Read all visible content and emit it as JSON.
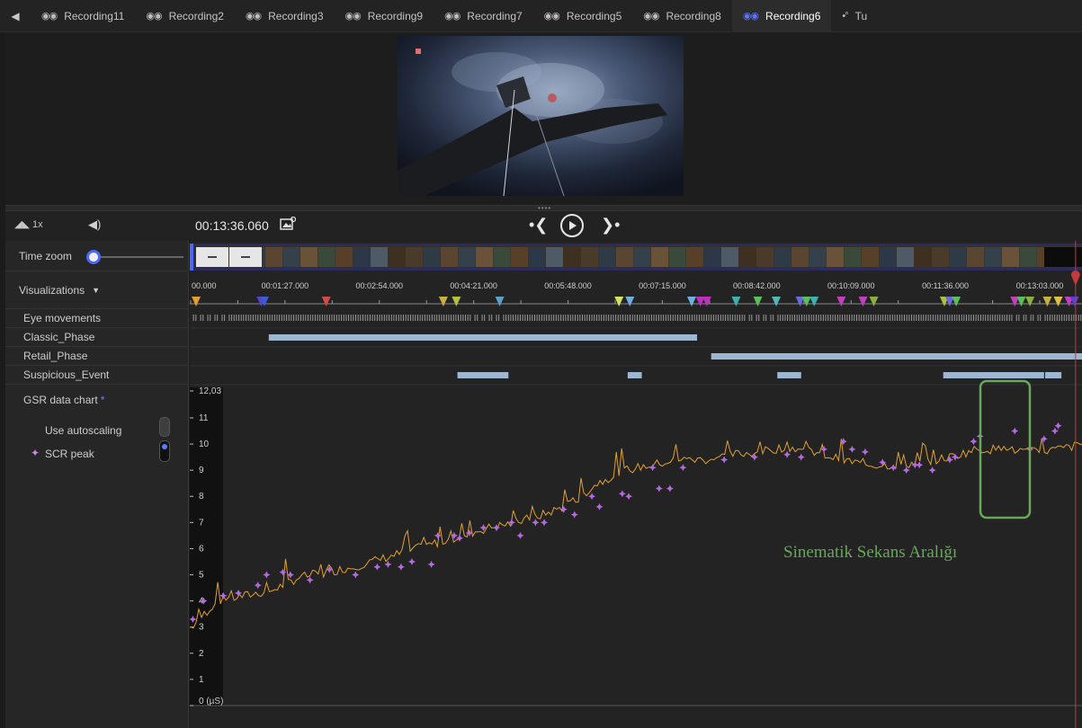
{
  "tabs": [
    {
      "label": "Recording11",
      "active": false
    },
    {
      "label": "Recording2",
      "active": false
    },
    {
      "label": "Recording3",
      "active": false
    },
    {
      "label": "Recording9",
      "active": false
    },
    {
      "label": "Recording7",
      "active": false
    },
    {
      "label": "Recording5",
      "active": false
    },
    {
      "label": "Recording8",
      "active": false
    },
    {
      "label": "Recording6",
      "active": true
    },
    {
      "label": "Tu",
      "active": false
    }
  ],
  "controls": {
    "speed": "1x",
    "current_time": "00:13:36.060"
  },
  "sidebar": {
    "time_zoom": "Time zoom",
    "visualizations": "Visualizations",
    "eye_movements": "Eye movements",
    "classic_phase": "Classic_Phase",
    "retail_phase": "Retail_Phase",
    "suspicious_event": "Suspicious_Event",
    "gsr_title": "GSR data chart",
    "gsr_asterisk": "*",
    "use_autoscaling": "Use autoscaling",
    "scr_peak": "SCR peak"
  },
  "timeline": {
    "ticks": [
      "00.000",
      "00:01:27.000",
      "00:02:54.000",
      "00:04:21.000",
      "00:05:48.000",
      "00:07:15.000",
      "00:08:42.000",
      "00:10:09.000",
      "00:11:36.000",
      "00:13:03.000"
    ],
    "tick_seconds": [
      0,
      87,
      174,
      261,
      348,
      435,
      522,
      609,
      696,
      783
    ],
    "playhead_seconds": 816.06,
    "classic_phase_seconds": [
      [
        72,
        467
      ]
    ],
    "retail_phase_seconds": [
      [
        480,
        841
      ]
    ],
    "suspicious_event_seconds": [
      [
        246,
        293
      ],
      [
        403,
        416
      ],
      [
        541,
        563
      ],
      [
        694,
        787
      ],
      [
        788,
        803
      ]
    ]
  },
  "annotation": "Sinematik Sekans Aralığı",
  "colors": {
    "accent": "#5a73ff",
    "gsr_line": "#e0a030",
    "scr_peak": "#b46be0",
    "phase_bar": "#9db6d1",
    "playhead": "#c43a3a",
    "annotation": "#67a85a"
  },
  "chart_data": {
    "type": "line",
    "title": "GSR data chart",
    "ylabel": "",
    "ylim": [
      0,
      12.03
    ],
    "ytick_labels": [
      "0 (µS)",
      "1",
      "2",
      "3",
      "4",
      "5",
      "6",
      "7",
      "8",
      "9",
      "10",
      "11",
      "12,03"
    ],
    "series": [
      {
        "name": "GSR",
        "x_seconds": [
          0,
          25,
          50,
          75,
          100,
          125,
          150,
          175,
          200,
          225,
          250,
          275,
          300,
          325,
          350,
          375,
          400,
          425,
          450,
          475,
          500,
          525,
          550,
          575,
          600,
          625,
          650,
          675,
          700,
          725,
          750,
          775,
          800,
          825,
          842
        ],
        "values": [
          3.0,
          4.0,
          4.2,
          4.4,
          4.9,
          5.1,
          5.3,
          5.6,
          5.9,
          6.2,
          6.5,
          6.8,
          7.0,
          7.3,
          7.7,
          8.5,
          9.0,
          9.2,
          9.4,
          9.4,
          9.6,
          9.7,
          9.9,
          9.7,
          9.4,
          9.2,
          9.2,
          9.3,
          9.5,
          9.8,
          9.8,
          9.7,
          9.8,
          10.0,
          10.4
        ]
      },
      {
        "name": "SCR peak",
        "x_seconds": [
          2,
          12,
          30,
          44,
          62,
          70,
          85,
          92,
          110,
          128,
          152,
          172,
          182,
          194,
          204,
          222,
          228,
          243,
          248,
          257,
          270,
          282,
          296,
          304,
          318,
          326,
          344,
          354,
          370,
          377,
          398,
          404,
          426,
          432,
          442,
          454,
          492,
          520,
          550,
          563,
          584,
          602,
          610,
          622,
          638,
          648,
          660,
          668,
          672,
          684,
          700,
          705,
          722,
          728,
          760,
          774,
          787,
          797,
          800
        ],
        "values": [
          3.3,
          4.0,
          4.2,
          4.3,
          4.6,
          5.0,
          5.1,
          5.0,
          4.8,
          5.2,
          5.0,
          5.3,
          5.4,
          5.3,
          5.5,
          5.4,
          6.5,
          6.5,
          6.4,
          6.6,
          6.8,
          6.8,
          7.0,
          6.5,
          7.0,
          7.0,
          7.5,
          7.3,
          8.0,
          7.6,
          8.1,
          8.0,
          9.1,
          8.3,
          8.3,
          9.1,
          9.4,
          9.5,
          9.6,
          9.5,
          9.8,
          10.1,
          9.8,
          9.7,
          9.3,
          9.1,
          9.0,
          9.2,
          9.2,
          9.0,
          9.4,
          9.5,
          10.1,
          10.3,
          10.5,
          9.8,
          10.2,
          10.5,
          10.7
        ]
      }
    ]
  }
}
